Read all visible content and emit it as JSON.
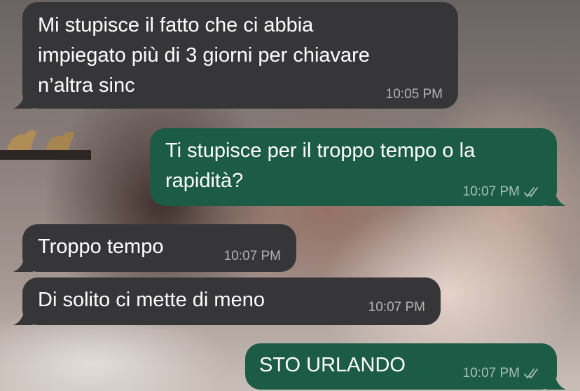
{
  "chat": {
    "messages": [
      {
        "direction": "incoming",
        "lines": [
          "Mi stupisce il fatto che ci abbia",
          "impiegato più di 3 giorni per chiavare",
          "n’altra sinc"
        ],
        "time": "10:05 PM"
      },
      {
        "direction": "outgoing",
        "lines": [
          "Ti stupisce per il troppo tempo o la",
          "rapidità?"
        ],
        "time": "10:07 PM",
        "status_icon": "double-check-icon"
      },
      {
        "direction": "incoming",
        "lines": [
          "Troppo tempo"
        ],
        "time": "10:07 PM"
      },
      {
        "direction": "incoming",
        "lines": [
          "Di solito ci mette di meno"
        ],
        "time": "10:07 PM"
      },
      {
        "direction": "outgoing",
        "lines": [
          "STO URLANDO"
        ],
        "time": "10:07 PM",
        "status_icon": "double-check-icon"
      }
    ]
  },
  "colors": {
    "incoming_bubble": "#363638",
    "outgoing_bubble": "#1c5b46",
    "text": "#ffffff",
    "meta": "#9f9f9f"
  }
}
